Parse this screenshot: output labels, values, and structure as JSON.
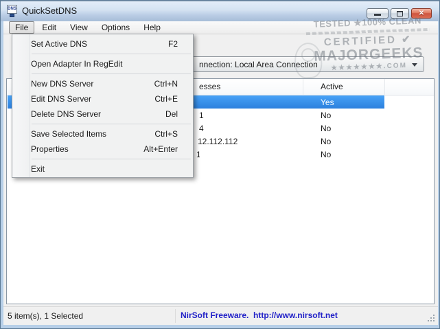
{
  "window": {
    "title": "QuickSetDNS",
    "app_icon_text": "DNS",
    "close_glyph": "✕"
  },
  "menubar": {
    "items": [
      {
        "label": "File"
      },
      {
        "label": "Edit"
      },
      {
        "label": "View"
      },
      {
        "label": "Options"
      },
      {
        "label": "Help"
      }
    ]
  },
  "file_menu": {
    "items": [
      {
        "label": "Set Active DNS",
        "shortcut": "F2"
      },
      {
        "label": "Open Adapter In RegEdit",
        "shortcut": ""
      },
      {
        "label": "New DNS Server",
        "shortcut": "Ctrl+N"
      },
      {
        "label": "Edit DNS Server",
        "shortcut": "Ctrl+E"
      },
      {
        "label": "Delete DNS Server",
        "shortcut": "Del"
      },
      {
        "label": "Save Selected Items",
        "shortcut": "Ctrl+S"
      },
      {
        "label": "Properties",
        "shortcut": "Alt+Enter"
      },
      {
        "label": "Exit",
        "shortcut": ""
      }
    ]
  },
  "toolbar": {
    "connection_combo_visible_text": "nnection: Local Area Connection"
  },
  "list": {
    "header": {
      "col_addresses_visible_text": "esses",
      "col_active": "Active"
    },
    "rows": [
      {
        "address_visible_text": "",
        "active": "Yes",
        "selected": true
      },
      {
        "address_visible_text": "1",
        "active": "No",
        "selected": false
      },
      {
        "address_visible_text": "4",
        "active": "No",
        "selected": false
      },
      {
        "address_visible_text": "12.112.112",
        "active": "No",
        "selected": false
      },
      {
        "address_visible_text": "1",
        "active": "No",
        "selected": false
      }
    ]
  },
  "statusbar": {
    "left_text": "5 item(s), 1 Selected",
    "right_text": "NirSoft Freeware.  http://www.nirsoft.net"
  },
  "watermark": {
    "line1": "TESTED ★100% CLEAN",
    "line2": "CERTIFIED ✔",
    "line3": "MAJORGEEKS",
    "line4": "★★★★★★★.COM"
  },
  "colors": {
    "selection_blue": "#2f8df5",
    "freeware_link_blue": "#2222c8",
    "close_button_red": "#cf5540",
    "titlebar_blue": "#bacde5"
  }
}
